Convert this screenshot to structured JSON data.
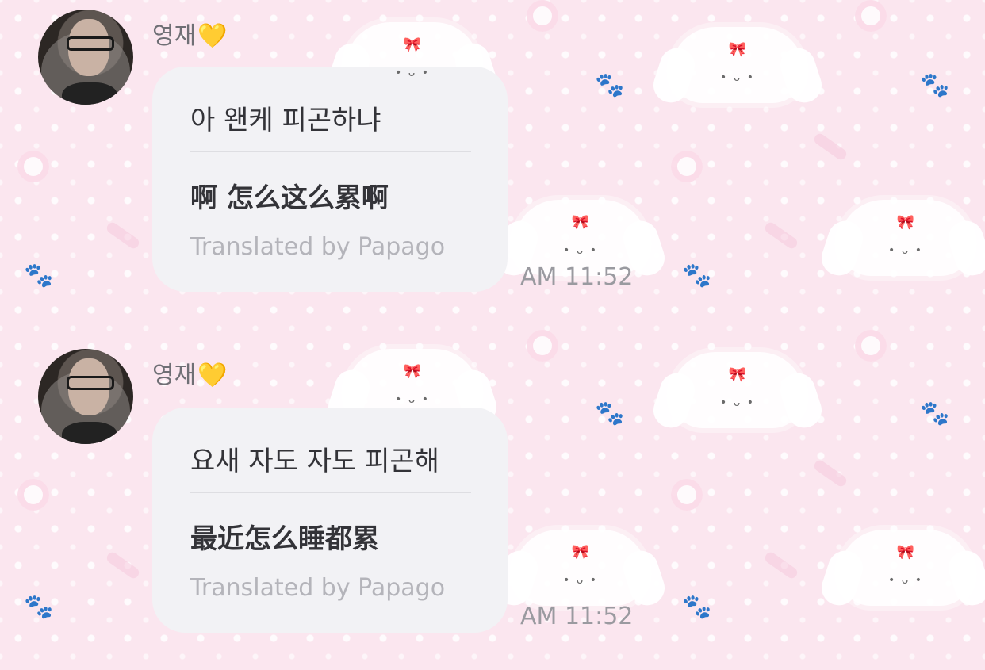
{
  "messages": [
    {
      "sender": "영재",
      "sender_emoji": "💛",
      "original_text": "아 왠케 피곤하냐",
      "translated_text": "啊 怎么这么累啊",
      "translation_credit": "Translated by Papago",
      "time": "AM 11:52"
    },
    {
      "sender": "영재",
      "sender_emoji": "💛",
      "original_text": "요새 자도 자도 피곤해",
      "translated_text": "最近怎么睡都累",
      "translation_credit": "Translated by Papago",
      "time": "AM 11:52"
    }
  ],
  "colors": {
    "background": "#fbe6ef",
    "bubble": "#f2f2f5",
    "text": "#333338",
    "muted_text": "#b4b4ba",
    "time_text": "#9a9aa0",
    "heart": "#f7c21e"
  },
  "icons": {
    "sender_badge": "yellow-heart-icon",
    "background_pattern": "puppy-wallpaper"
  }
}
